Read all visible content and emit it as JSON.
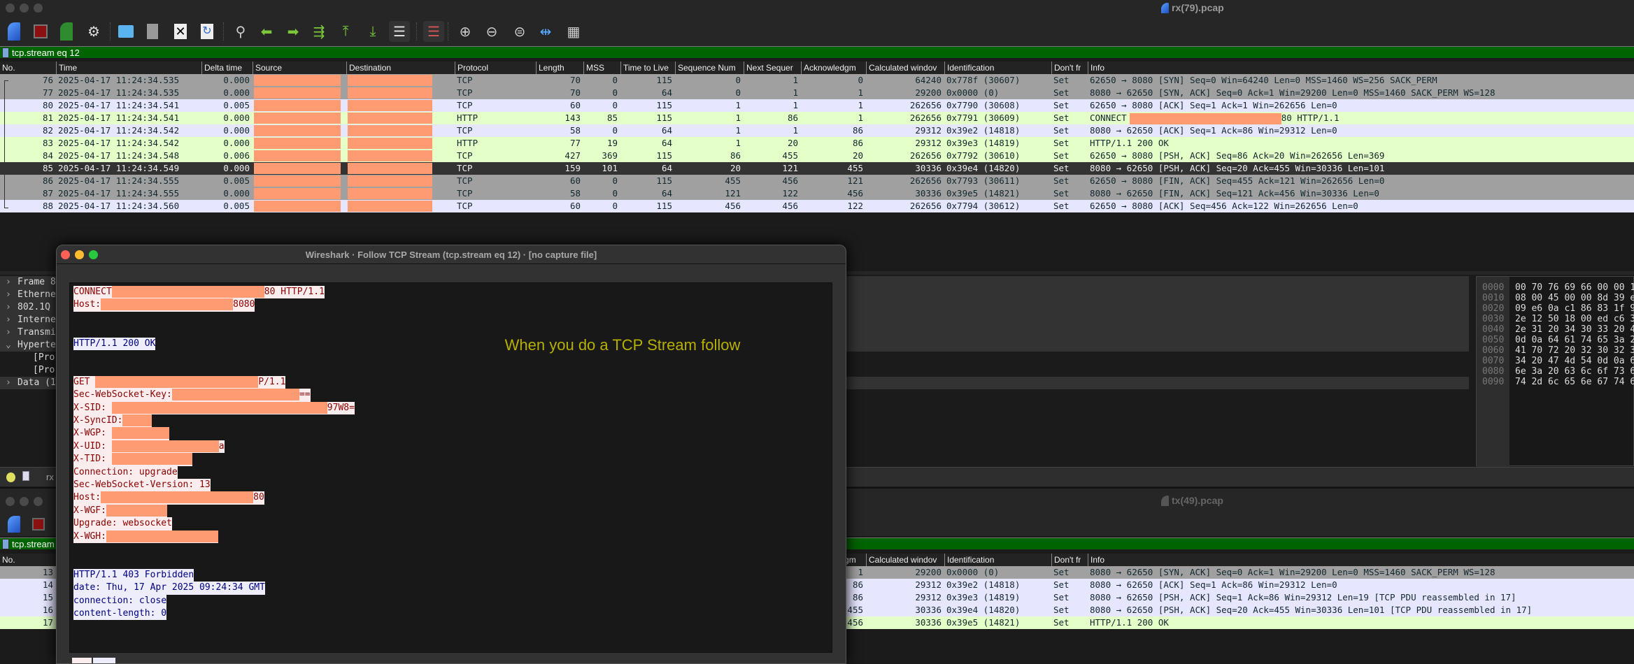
{
  "top_window": {
    "title": "rx(79).pcap",
    "toolbar": [
      "shark-start-icon",
      "stop-capture-icon",
      "restart-capture-icon",
      "capture-options-icon",
      "open-file-icon",
      "save-file-icon",
      "close-file-icon",
      "reload-file-icon",
      "find-packet-icon",
      "go-back-icon",
      "go-forward-icon",
      "go-to-packet-icon",
      "first-packet-icon",
      "last-packet-icon",
      "autoscroll-icon",
      "colorize-icon",
      "zoom-in-icon",
      "zoom-out-icon",
      "zoom-reset-icon",
      "resize-columns-icon",
      "layout-icon"
    ],
    "filter": "tcp.stream eq 12",
    "columns": [
      "No.",
      "Time",
      "Delta time",
      "Source",
      "Destination",
      "Protocol",
      "Length",
      "MSS",
      "Time to Live",
      "Sequence Num",
      "Next Sequer",
      "Acknowledgm",
      "Calculated windov",
      "Identification",
      "Don't fr",
      "Info"
    ],
    "packets": [
      {
        "no": "76",
        "time": "2025-04-17 11:24:34.535",
        "delta": "0.000",
        "proto": "TCP",
        "len": "70",
        "mss": "0",
        "ttl": "115",
        "seq": "0",
        "nseq": "1",
        "ack": "0",
        "win": "64240",
        "id": "0x778f (30607)",
        "df": "Set",
        "info": "62650 → 8080 [SYN] Seq=0 Win=64240 Len=0 MSS=1460 WS=256 SACK_PERM",
        "color": "gray"
      },
      {
        "no": "77",
        "time": "2025-04-17 11:24:34.535",
        "delta": "0.000",
        "proto": "TCP",
        "len": "70",
        "mss": "0",
        "ttl": "64",
        "seq": "0",
        "nseq": "1",
        "ack": "1",
        "win": "29200",
        "id": "0x0000 (0)",
        "df": "Set",
        "info": "8080 → 62650 [SYN, ACK] Seq=0 Ack=1 Win=29200 Len=0 MSS=1460 SACK_PERM WS=128",
        "color": "gray"
      },
      {
        "no": "80",
        "time": "2025-04-17 11:24:34.541",
        "delta": "0.005",
        "proto": "TCP",
        "len": "60",
        "mss": "0",
        "ttl": "115",
        "seq": "1",
        "nseq": "1",
        "ack": "1",
        "win": "262656",
        "id": "0x7790 (30608)",
        "df": "Set",
        "info": "62650 → 8080 [ACK] Seq=1 Ack=1 Win=262656 Len=0",
        "color": "lav"
      },
      {
        "no": "81",
        "time": "2025-04-17 11:24:34.541",
        "delta": "0.000",
        "proto": "HTTP",
        "len": "143",
        "mss": "85",
        "ttl": "115",
        "seq": "1",
        "nseq": "86",
        "ack": "1",
        "win": "262656",
        "id": "0x7791 (30609)",
        "df": "Set",
        "info": "CONNECT",
        "info_suffix": "80 HTTP/1.1",
        "color": "grn"
      },
      {
        "no": "82",
        "time": "2025-04-17 11:24:34.542",
        "delta": "0.000",
        "proto": "TCP",
        "len": "58",
        "mss": "0",
        "ttl": "64",
        "seq": "1",
        "nseq": "1",
        "ack": "86",
        "win": "29312",
        "id": "0x39e2 (14818)",
        "df": "Set",
        "info": "8080 → 62650 [ACK] Seq=1 Ack=86 Win=29312 Len=0",
        "color": "lav"
      },
      {
        "no": "83",
        "time": "2025-04-17 11:24:34.542",
        "delta": "0.000",
        "proto": "HTTP",
        "len": "77",
        "mss": "19",
        "ttl": "64",
        "seq": "1",
        "nseq": "20",
        "ack": "86",
        "win": "29312",
        "id": "0x39e3 (14819)",
        "df": "Set",
        "info": "HTTP/1.1 200 OK",
        "color": "grn"
      },
      {
        "no": "84",
        "time": "2025-04-17 11:24:34.548",
        "delta": "0.006",
        "proto": "TCP",
        "len": "427",
        "mss": "369",
        "ttl": "115",
        "seq": "86",
        "nseq": "455",
        "ack": "20",
        "win": "262656",
        "id": "0x7792 (30610)",
        "df": "Set",
        "info": "62650 → 8080 [PSH, ACK] Seq=86 Ack=20 Win=262656 Len=369",
        "color": "grn"
      },
      {
        "no": "85",
        "time": "2025-04-17 11:24:34.549",
        "delta": "0.000",
        "proto": "TCP",
        "len": "159",
        "mss": "101",
        "ttl": "64",
        "seq": "20",
        "nseq": "121",
        "ack": "455",
        "win": "30336",
        "id": "0x39e4 (14820)",
        "df": "Set",
        "info": "8080 → 62650 [PSH, ACK] Seq=20 Ack=455 Win=30336 Len=101",
        "color": "sel"
      },
      {
        "no": "86",
        "time": "2025-04-17 11:24:34.555",
        "delta": "0.005",
        "proto": "TCP",
        "len": "60",
        "mss": "0",
        "ttl": "115",
        "seq": "455",
        "nseq": "456",
        "ack": "121",
        "win": "262656",
        "id": "0x7793 (30611)",
        "df": "Set",
        "info": "62650 → 8080 [FIN, ACK] Seq=455 Ack=121 Win=262656 Len=0",
        "color": "gray"
      },
      {
        "no": "87",
        "time": "2025-04-17 11:24:34.555",
        "delta": "0.000",
        "proto": "TCP",
        "len": "58",
        "mss": "0",
        "ttl": "64",
        "seq": "121",
        "nseq": "122",
        "ack": "456",
        "win": "30336",
        "id": "0x39e5 (14821)",
        "df": "Set",
        "info": "8080 → 62650 [FIN, ACK] Seq=121 Ack=456 Win=30336 Len=0",
        "color": "gray"
      },
      {
        "no": "88",
        "time": "2025-04-17 11:24:34.560",
        "delta": "0.005",
        "proto": "TCP",
        "len": "60",
        "mss": "0",
        "ttl": "115",
        "seq": "456",
        "nseq": "456",
        "ack": "122",
        "win": "262656",
        "id": "0x7794 (30612)",
        "df": "Set",
        "info": "62650 → 8080 [ACK] Seq=456 Ack=122 Win=262656 Len=0",
        "color": "lav"
      }
    ],
    "details": [
      {
        "label": "Frame 8",
        "expanded": false
      },
      {
        "label": "Etherne",
        "expanded": false
      },
      {
        "label": "802.1Q",
        "expanded": false
      },
      {
        "label": "Interne",
        "expanded": false
      },
      {
        "label": "Transmi",
        "expanded": false
      },
      {
        "label": "Hyperte",
        "expanded": true
      },
      {
        "label": "[Pro",
        "child": true
      },
      {
        "label": "[Pro",
        "child": true
      },
      {
        "label": "Data (1",
        "expanded": false
      }
    ],
    "hex": [
      {
        "off": "0000",
        "bytes": "00 70 76 69 66 00 00 1"
      },
      {
        "off": "0010",
        "bytes": "08 00 45 00 00 8d 39 e"
      },
      {
        "off": "0020",
        "bytes": "09 e6 0a c1 86 83 1f 9"
      },
      {
        "off": "0030",
        "bytes": "2e 12 50 18 00 ed c6 3"
      },
      {
        "off": "0040",
        "bytes": "2e 31 20 34 30 33 20 4"
      },
      {
        "off": "0050",
        "bytes": "0d 0a 64 61 74 65 3a 2"
      },
      {
        "off": "0060",
        "bytes": "41 70 72 20 32 30 32 3"
      },
      {
        "off": "0070",
        "bytes": "34 20 47 4d 54 0d 0a 6"
      },
      {
        "off": "0080",
        "bytes": "6e 3a 20 63 6c 6f 73 6"
      },
      {
        "off": "0090",
        "bytes": "74 2d 6c 65 6e 67 74 6"
      }
    ],
    "status_text": "rx"
  },
  "bottom_window": {
    "title": "tx(49).pcap",
    "filter": "tcp.stream",
    "columns": [
      "No.",
      "Acknowledgm",
      "Calculated windov",
      "Identification",
      "Don't fr",
      "Info"
    ],
    "packets": [
      {
        "no": "13",
        "ack": "1",
        "win": "29200",
        "id": "0x0000 (0)",
        "df": "Set",
        "info": "8080 → 62650 [SYN, ACK] Seq=0 Ack=1 Win=29200 Len=0 MSS=1460 SACK_PERM WS=128",
        "color": "gray"
      },
      {
        "no": "14",
        "ack": "86",
        "win": "29312",
        "id": "0x39e2 (14818)",
        "df": "Set",
        "info": "8080 → 62650 [ACK] Seq=1 Ack=86 Win=29312 Len=0",
        "color": "lav"
      },
      {
        "no": "15",
        "ack": "86",
        "win": "29312",
        "id": "0x39e3 (14819)",
        "df": "Set",
        "info": "8080 → 62650 [PSH, ACK] Seq=1 Ack=86 Win=29312 Len=19 [TCP PDU reassembled in 17]",
        "color": "lav"
      },
      {
        "no": "16",
        "ack": "455",
        "win": "30336",
        "id": "0x39e4 (14820)",
        "df": "Set",
        "info": "8080 → 62650 [PSH, ACK] Seq=20 Ack=455 Win=30336 Len=101 [TCP PDU reassembled in 17]",
        "color": "lav"
      },
      {
        "no": "17",
        "ack": "456",
        "win": "30336",
        "id": "0x39e5 (14821)",
        "df": "Set",
        "info": "HTTP/1.1 200 OK",
        "color": "grn"
      }
    ]
  },
  "follow": {
    "title": "Wireshark · Follow TCP Stream (tcp.stream eq 12) · [no capture file]",
    "annotation": "When you do a TCP Stream follow",
    "lines": {
      "connect": {
        "pre": "CONNECT",
        "post": "80 HTTP/1.1"
      },
      "host1": {
        "pre": "Host:",
        "post": "8080"
      },
      "ok": "HTTP/1.1 200 OK",
      "get": {
        "pre": "GET ",
        "post": "P/1.1"
      },
      "wskey": {
        "pre": "Sec-WebSocket-Key:",
        "post": "=="
      },
      "sid": {
        "pre": "X-SID: ",
        "post": "97W8="
      },
      "sync": {
        "pre": "X-SyncID:"
      },
      "wgp": {
        "pre": "X-WGP: "
      },
      "uid": {
        "pre": "X-UID: ",
        "post": "a"
      },
      "tid": {
        "pre": "X-TID: "
      },
      "conn": "Connection: upgrade",
      "wsver": "Sec-WebSocket-Version: 13",
      "host2": {
        "pre": "Host:",
        "post": "80"
      },
      "wgf": {
        "pre": "X-WGF:"
      },
      "upgrade": "Upgrade: websocket",
      "wgh": {
        "pre": "X-WGH:"
      },
      "forbidden": "HTTP/1.1 403 Forbidden",
      "date": "date: Thu, 17 Apr 2025 09:24:34 GMT",
      "connclose": "connection: close",
      "clen": "content-length: 0"
    }
  },
  "colors": {
    "filter_bg": "#006400",
    "row_gray": "#a0a0a0",
    "row_lavender": "#e7e6ff",
    "row_green": "#e4ffc7",
    "row_selected": "#333333",
    "client_text": "#8b0000",
    "server_text": "#000080",
    "annotation": "#b8b000",
    "redaction": "#ff9b73"
  }
}
